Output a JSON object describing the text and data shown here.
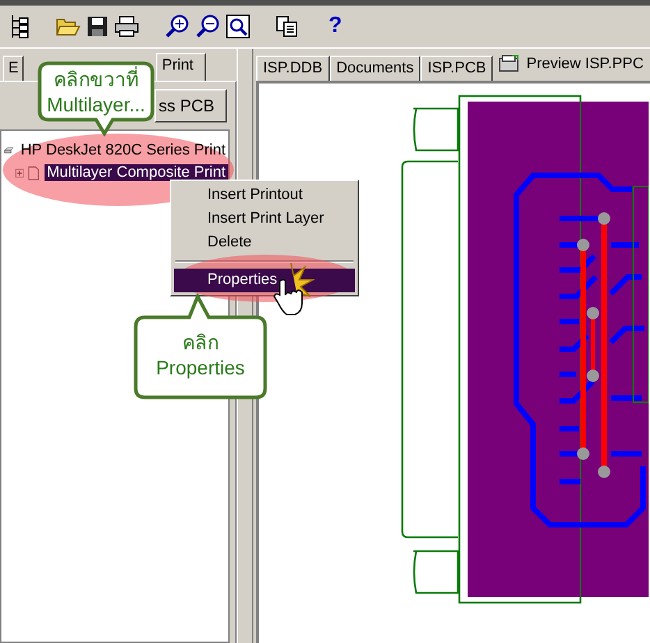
{
  "toolbar": {
    "help_label": "?"
  },
  "left_panel": {
    "tabs": [
      {
        "label": "E",
        "selected": false
      },
      {
        "label": "Print",
        "selected": true
      }
    ],
    "button": "ss PCB",
    "tree": [
      {
        "kind": "printer",
        "label": "HP DeskJet 820C Series Print",
        "selected": false,
        "children": [
          {
            "kind": "document",
            "label": "Multilayer Composite Print",
            "selected": true,
            "expanded": false
          }
        ]
      }
    ]
  },
  "document_tabs": [
    {
      "kind": "plain",
      "label": "ISP.DDB",
      "selected": false
    },
    {
      "kind": "plain",
      "label": "Documents",
      "selected": false
    },
    {
      "kind": "plain",
      "label": "ISP.PCB",
      "selected": false
    },
    {
      "kind": "preview",
      "label": "Preview ISP.PPC",
      "selected": true
    }
  ],
  "context_menu": {
    "items": [
      {
        "kind": "item",
        "label": "Insert Printout",
        "selected": false
      },
      {
        "kind": "item",
        "label": "Insert Print Layer",
        "selected": false
      },
      {
        "kind": "item",
        "label": "Delete",
        "selected": false
      },
      {
        "kind": "separator"
      },
      {
        "kind": "item",
        "label": "Properties",
        "selected": true
      }
    ]
  },
  "callouts": [
    {
      "lines": [
        "คลิกขวาที่",
        "Multilayer..."
      ]
    },
    {
      "lines": [
        "คลิก",
        "Properties"
      ]
    }
  ]
}
